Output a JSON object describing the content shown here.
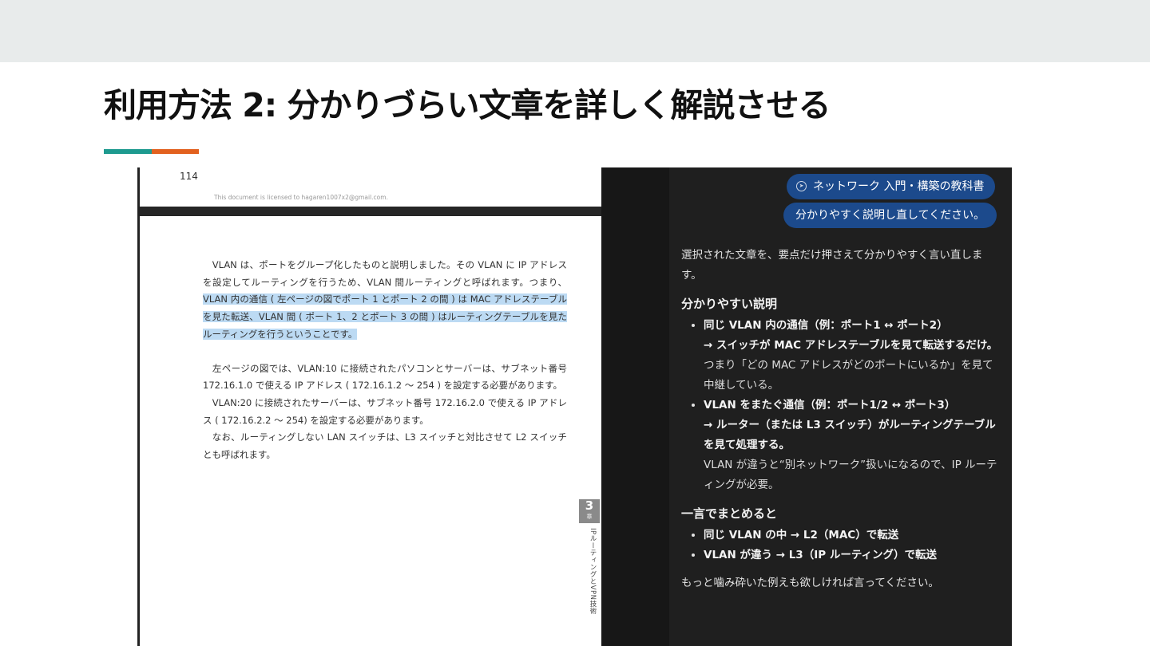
{
  "slide": {
    "title": "利用方法 2: 分かりづらい文章を詳しく解説させる"
  },
  "book": {
    "page_number": "114",
    "license": "This document is licensed to hagaren1007x2@gmail.com.",
    "para1_pre": "VLAN は、ポートをグループ化したものと説明しました。その VLAN に IP アドレスを設定してルーティングを行うため、VLAN 間ルーティングと呼ばれます。つまり、",
    "para1_highlight": "VLAN 内の通信 ( 左ページの図でポート 1 とポート 2 の間 ) は MAC アドレステーブルを見た転送、VLAN 間 ( ポート 1、2 とポート 3 の間 ) はルーティングテーブルを見たルーティングを行うということです。",
    "para2": "左ページの図では、VLAN:10 に接続されたパソコンとサーバーは、サブネット番号 172.16.1.0 で使える IP アドレス ( 172.16.1.2 〜 254 ) を設定する必要があります。",
    "para3": "VLAN:20 に接続されたサーバーは、サブネット番号 172.16.2.0 で使える IP アドレス ( 172.16.2.2 〜 254) を設定する必要があります。",
    "para4": "なお、ルーティングしない LAN スイッチは、L3 スイッチと対比させて L2 スイッチとも呼ばれます。",
    "chapter_number": "3",
    "chapter_label": "章",
    "chapter_title": "IPルーティングとVPN技術"
  },
  "chat": {
    "source_chip": "ネットワーク 入門・構築の教科書",
    "source_icon": "compass-icon",
    "user_message": "分かりやすく説明し直してください。",
    "intro": "選択された文章を、要点だけ押さえて分かりやすく言い直します。",
    "heading1": "分かりやすい説明",
    "items": [
      {
        "bold1": "同じ VLAN 内の通信（例：ポート1 ↔ ポート2）",
        "bold2": "→ スイッチが MAC アドレステーブルを見て転送するだけ。",
        "note": "つまり「どの MAC アドレスがどのポートにいるか」を見て中継している。"
      },
      {
        "bold1": "VLAN をまたぐ通信（例：ポート1/2 ↔ ポート3）",
        "bold2": "→ ルーター（または L3 スイッチ）がルーティングテーブルを見て処理する。",
        "note": "VLAN が違うと“別ネットワーク”扱いになるので、IP ルーティングが必要。"
      }
    ],
    "heading2": "一言でまとめると",
    "summary": [
      "同じ VLAN の中 → L2（MAC）で転送",
      "VLAN が違う → L3（IP ルーティング）で転送"
    ],
    "closing": "もっと噛み砕いた例えも欲しければ言ってください。"
  },
  "colors": {
    "topbar": "#e8ebeb",
    "accent_teal": "#1e9a8f",
    "accent_orange": "#e2611f",
    "highlight": "#bcdaf3",
    "chat_bg": "#1f1f1f",
    "chip_bg": "#1c4a8c"
  }
}
